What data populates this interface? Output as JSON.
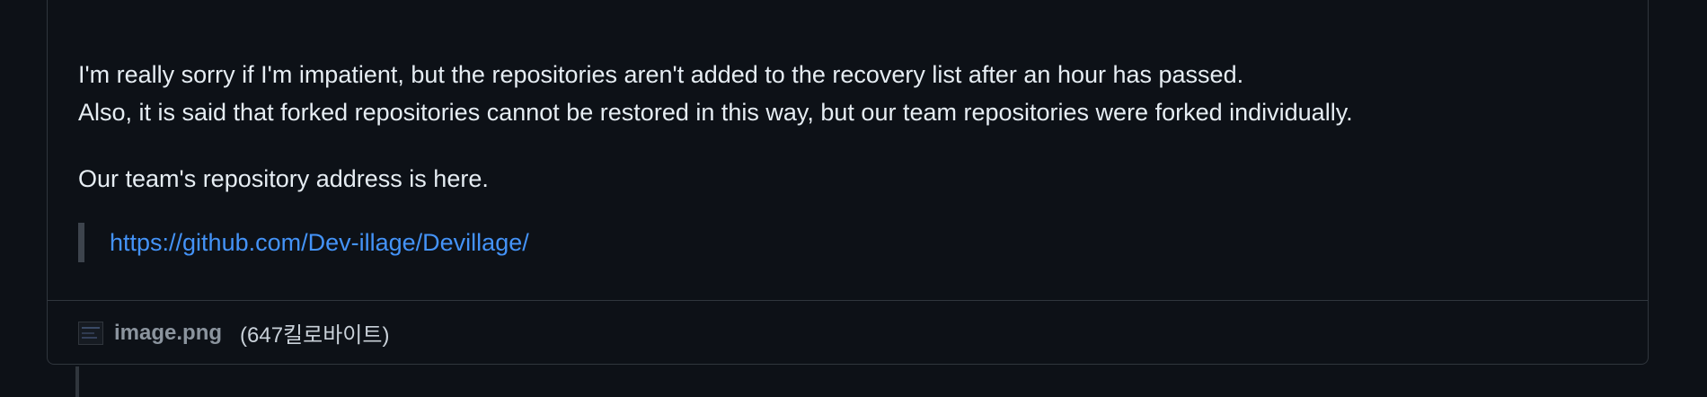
{
  "comment": {
    "line1": "I'm really sorry if I'm impatient, but the repositories aren't added to the recovery list after an hour has passed.",
    "line2": "Also, it is said that forked repositories cannot be restored in this way, but our team repositories were forked individually.",
    "line3": "Our team's repository address is here.",
    "quote_link": "https://github.com/Dev-illage/Devillage/"
  },
  "attachment": {
    "icon": "image-thumbnail-icon",
    "file_name": "image.png",
    "file_size": "(647킬로바이트)"
  },
  "colors": {
    "background": "#0d1117",
    "border": "#30363d",
    "text": "#e6edf3",
    "link": "#4493f8"
  }
}
